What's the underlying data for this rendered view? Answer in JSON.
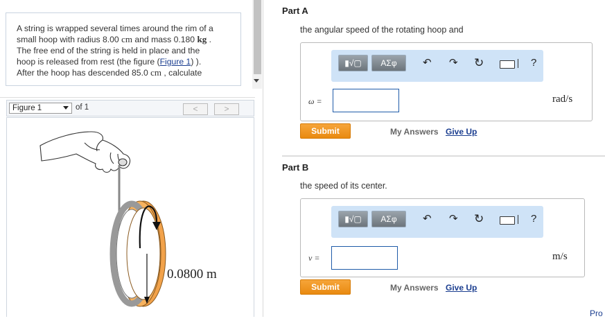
{
  "problem": {
    "line1": "A string is wrapped several times around the rim of a",
    "line2_pre": "small hoop with radius 8.00 ",
    "radius_unit": "cm",
    "line2_mid": " and mass 0.180 ",
    "mass_unit": "kg",
    "line2_post": " .",
    "line3": "The free end of the string is held in place and the",
    "line4_pre": "hoop is released from rest (the figure (",
    "figure_link": "Figure 1",
    "line4_post": ") ).",
    "line5_pre": "After the hoop has descended 85.0 ",
    "distance_unit": "cm",
    "line5_post": " , calculate"
  },
  "figure_nav": {
    "selected": "Figure 1",
    "of_label": "of 1",
    "prev_label": "<",
    "next_label": ">"
  },
  "figure": {
    "label": "0.0800 m",
    "hoop_color": "#f2a24a",
    "string_color": "#888888"
  },
  "parts": [
    {
      "title": "Part A",
      "question": "the angular speed of the rotating hoop and",
      "variable": "ω =",
      "unit": "rad/s",
      "submit_label": "Submit",
      "my_answers_label": "My Answers",
      "give_up_label": "Give Up"
    },
    {
      "title": "Part B",
      "question": "the speed of its center.",
      "variable": "v =",
      "unit": "m/s",
      "submit_label": "Submit",
      "my_answers_label": "My Answers",
      "give_up_label": "Give Up"
    }
  ],
  "toolbar": {
    "templates_label": "▮√▢",
    "symbols_label": "ΑΣφ",
    "undo_icon": "↶",
    "redo_icon": "↷",
    "reset_icon": "↻",
    "keyboard_icon": "keyboard-icon",
    "help_label": "?"
  },
  "footer_cut": "Pro"
}
